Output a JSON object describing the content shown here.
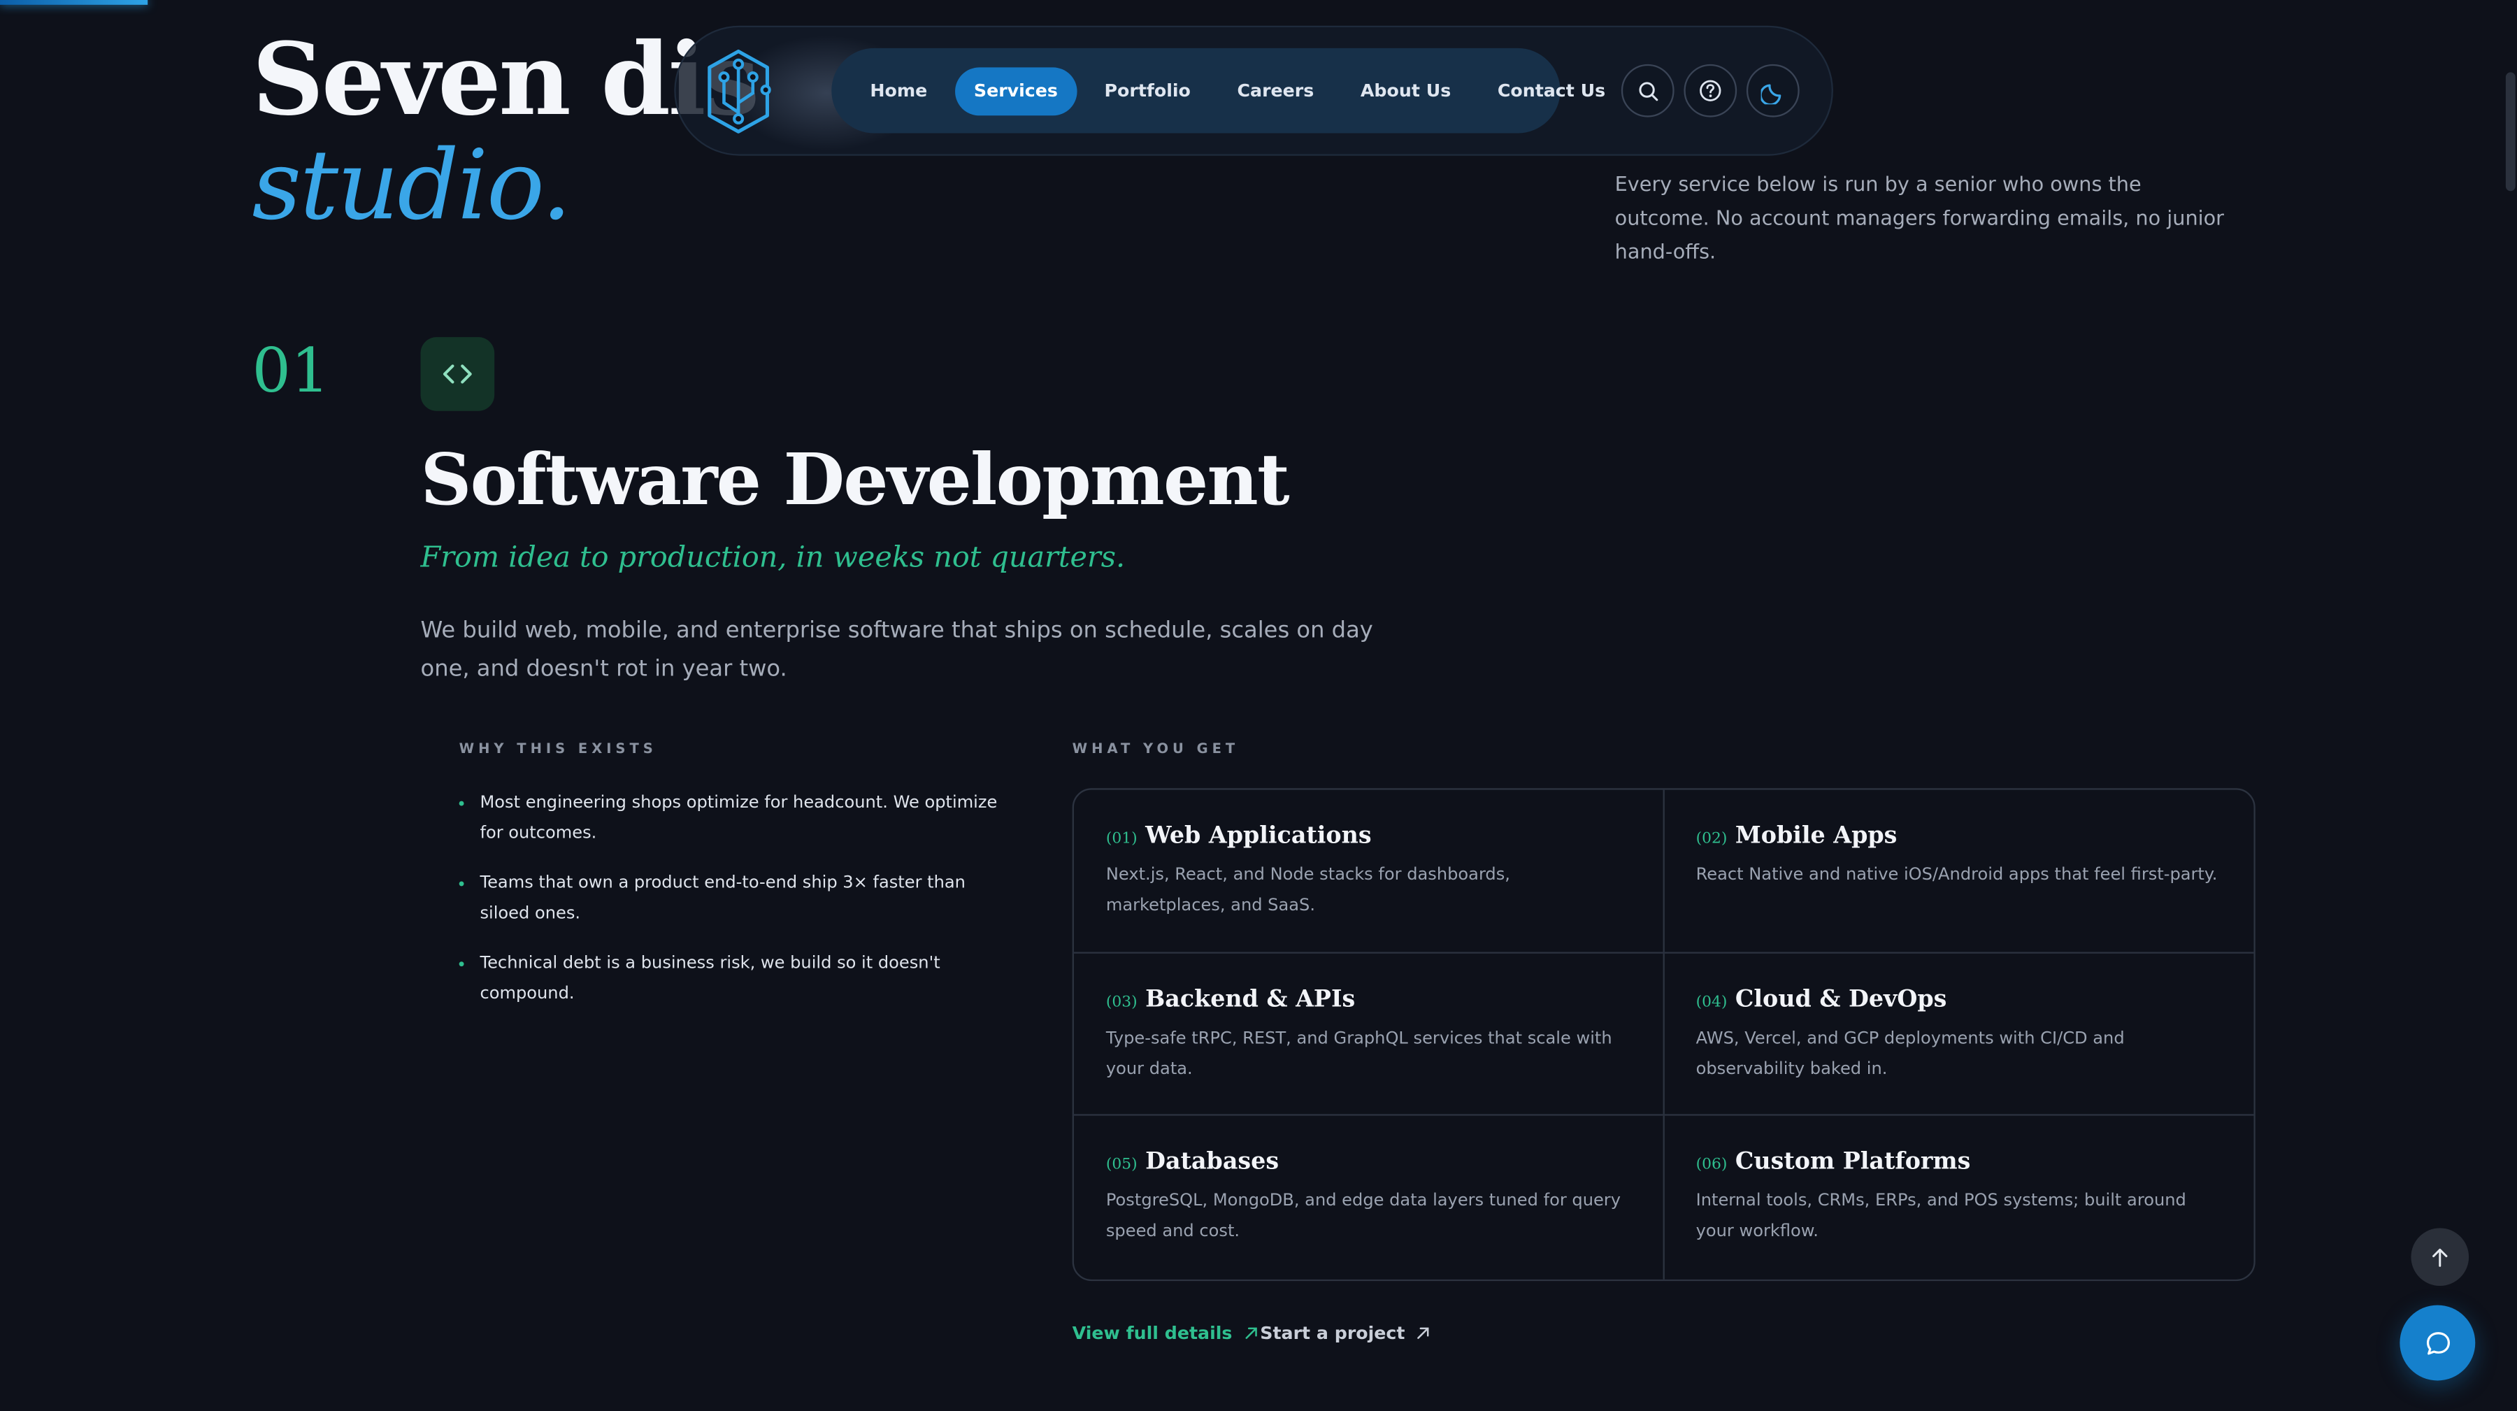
{
  "hero": {
    "title": "Seven dis",
    "accent": "studio.",
    "description": "Every service below is run by a senior who owns the outcome. No account managers forwarding emails, no junior hand-offs."
  },
  "nav": {
    "links": [
      {
        "label": "Home",
        "active": false
      },
      {
        "label": "Services",
        "active": true
      },
      {
        "label": "Portfolio",
        "active": false
      },
      {
        "label": "Careers",
        "active": false
      },
      {
        "label": "About Us",
        "active": false
      },
      {
        "label": "Contact Us",
        "active": false
      }
    ],
    "icons": [
      "search-icon",
      "help-icon",
      "moon-icon"
    ]
  },
  "section": {
    "number": "01",
    "icon": "code-icon",
    "title": "Software Development",
    "tagline": "From idea to production, in weeks not quarters.",
    "description": "We build web, mobile, and enterprise software that ships on schedule, scales on day one, and doesn't rot in year two.",
    "why_label": "WHY THIS EXISTS",
    "why_items": [
      "Most engineering shops optimize for headcount. We optimize for outcomes.",
      "Teams that own a product end-to-end ship 3× faster than siloed ones.",
      "Technical debt is a business risk, we build so it doesn't compound."
    ],
    "get_label": "WHAT YOU GET",
    "services": [
      {
        "num": "(01)",
        "title": "Web Applications",
        "desc": "Next.js, React, and Node stacks for dashboards, marketplaces, and SaaS."
      },
      {
        "num": "(02)",
        "title": "Mobile Apps",
        "desc": "React Native and native iOS/Android apps that feel first-party."
      },
      {
        "num": "(03)",
        "title": "Backend & APIs",
        "desc": "Type-safe tRPC, REST, and GraphQL services that scale with your data."
      },
      {
        "num": "(04)",
        "title": "Cloud & DevOps",
        "desc": "AWS, Vercel, and GCP deployments with CI/CD and observability baked in."
      },
      {
        "num": "(05)",
        "title": "Databases",
        "desc": "PostgreSQL, MongoDB, and edge data layers tuned for query speed and cost."
      },
      {
        "num": "(06)",
        "title": "Custom Platforms",
        "desc": "Internal tools, CRMs, ERPs, and POS systems; built around your workflow."
      }
    ],
    "primary_link": "View full details",
    "secondary_link": "Start a project"
  },
  "colors": {
    "background": "#0e111a",
    "accent_blue": "#3aa6e8",
    "accent_green": "#2fbf8f",
    "nav_active": "#1577c4"
  }
}
